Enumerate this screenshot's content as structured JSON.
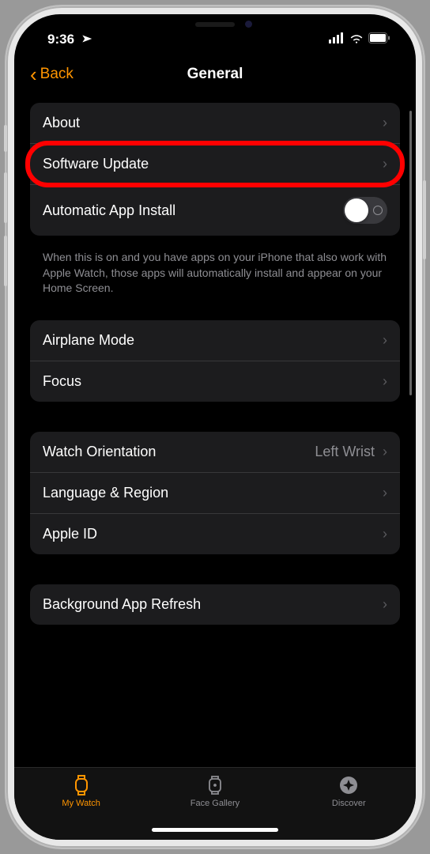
{
  "statusBar": {
    "time": "9:36"
  },
  "nav": {
    "back": "Back",
    "title": "General"
  },
  "sections": {
    "group1": {
      "about": "About",
      "softwareUpdate": "Software Update",
      "autoInstall": "Automatic App Install",
      "autoInstallOn": false,
      "footer": "When this is on and you have apps on your iPhone that also work with Apple Watch, those apps will automatically install and appear on your Home Screen."
    },
    "group2": {
      "airplaneMode": "Airplane Mode",
      "focus": "Focus"
    },
    "group3": {
      "watchOrientation": "Watch Orientation",
      "watchOrientationValue": "Left Wrist",
      "languageRegion": "Language & Region",
      "appleId": "Apple ID"
    },
    "group4": {
      "backgroundAppRefresh": "Background App Refresh"
    }
  },
  "tabs": {
    "myWatch": "My Watch",
    "faceGallery": "Face Gallery",
    "discover": "Discover"
  }
}
